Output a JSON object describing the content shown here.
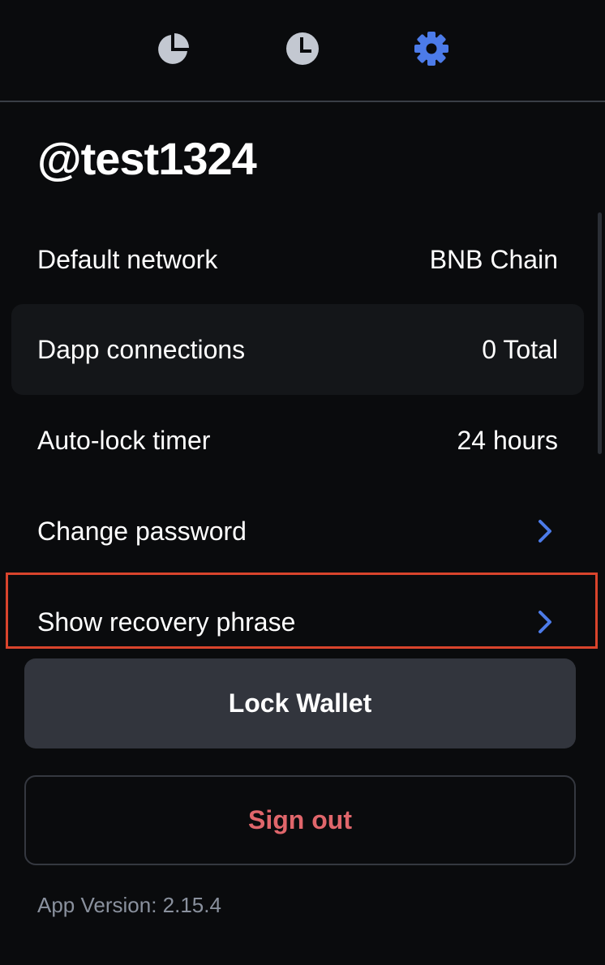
{
  "nav": {
    "tabs": [
      {
        "id": "portfolio",
        "icon": "pie-chart-icon",
        "active": false
      },
      {
        "id": "activity",
        "icon": "clock-icon",
        "active": false
      },
      {
        "id": "settings",
        "icon": "gear-icon",
        "active": true
      }
    ],
    "active_color": "#4c7be8",
    "inactive_color": "#c3c8d1"
  },
  "profile": {
    "username": "@test1324"
  },
  "settings": {
    "items": [
      {
        "label": "Default network",
        "value": "BNB Chain"
      },
      {
        "label": "Dapp connections",
        "value": "0 Total"
      },
      {
        "label": "Auto-lock timer",
        "value": "24 hours"
      },
      {
        "label": "Change password",
        "icon": "chevron-right-icon"
      },
      {
        "label": "Show recovery phrase",
        "icon": "chevron-right-icon"
      }
    ]
  },
  "actions": {
    "lock_label": "Lock Wallet",
    "signout_label": "Sign out",
    "signout_color": "#e0666b"
  },
  "footer": {
    "version": "App Version: 2.15.4"
  },
  "colors": {
    "background": "#0a0b0d",
    "accent": "#4c7be8",
    "highlight": "#d9442c"
  }
}
